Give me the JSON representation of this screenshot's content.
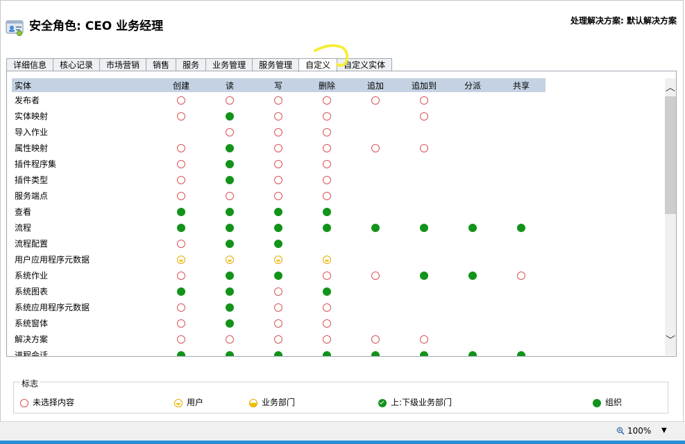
{
  "header": {
    "title": "安全角色: CEO 业务经理",
    "solution": "处理解决方案: 默认解决方案"
  },
  "tabs": [
    {
      "label": "详细信息",
      "active": false
    },
    {
      "label": "核心记录",
      "active": false
    },
    {
      "label": "市场营销",
      "active": false
    },
    {
      "label": "销售",
      "active": false
    },
    {
      "label": "服务",
      "active": false
    },
    {
      "label": "业务管理",
      "active": false
    },
    {
      "label": "服务管理",
      "active": false
    },
    {
      "label": "自定义",
      "active": true
    },
    {
      "label": "自定义实体",
      "active": false
    }
  ],
  "grid": {
    "columns": [
      "实体",
      "创建",
      "读",
      "写",
      "删除",
      "追加",
      "追加到",
      "分派",
      "共享"
    ],
    "rows": [
      {
        "entity": "发布者",
        "p": [
          "none",
          "none",
          "none",
          "none",
          "none",
          "none",
          "",
          ""
        ]
      },
      {
        "entity": "实体映射",
        "p": [
          "none",
          "org",
          "none",
          "none",
          "",
          "none",
          "",
          ""
        ]
      },
      {
        "entity": "导入作业",
        "p": [
          "",
          "none",
          "none",
          "none",
          "",
          "",
          "",
          ""
        ]
      },
      {
        "entity": "属性映射",
        "p": [
          "none",
          "org",
          "none",
          "none",
          "none",
          "none",
          "",
          ""
        ]
      },
      {
        "entity": "插件程序集",
        "p": [
          "none",
          "org",
          "none",
          "none",
          "",
          "",
          "",
          ""
        ]
      },
      {
        "entity": "插件类型",
        "p": [
          "none",
          "org",
          "none",
          "none",
          "",
          "",
          "",
          ""
        ]
      },
      {
        "entity": "服务端点",
        "p": [
          "none",
          "none",
          "none",
          "none",
          "",
          "",
          "",
          ""
        ]
      },
      {
        "entity": "查看",
        "p": [
          "org",
          "org",
          "org",
          "org",
          "",
          "",
          "",
          ""
        ]
      },
      {
        "entity": "流程",
        "p": [
          "org",
          "org",
          "org",
          "org",
          "org",
          "org",
          "org",
          "org"
        ]
      },
      {
        "entity": "流程配置",
        "p": [
          "none",
          "org",
          "org",
          "",
          "",
          "",
          "",
          ""
        ]
      },
      {
        "entity": "用户应用程序元数据",
        "p": [
          "user",
          "user",
          "user",
          "user",
          "",
          "",
          "",
          ""
        ]
      },
      {
        "entity": "系统作业",
        "p": [
          "none",
          "org",
          "org",
          "none",
          "none",
          "org",
          "org",
          "none"
        ]
      },
      {
        "entity": "系统图表",
        "p": [
          "org",
          "org",
          "none",
          "org",
          "",
          "",
          "",
          ""
        ]
      },
      {
        "entity": "系统应用程序元数据",
        "p": [
          "none",
          "org",
          "none",
          "none",
          "",
          "",
          "",
          ""
        ]
      },
      {
        "entity": "系统窗体",
        "p": [
          "none",
          "org",
          "none",
          "none",
          "",
          "",
          "",
          ""
        ]
      },
      {
        "entity": "解决方案",
        "p": [
          "none",
          "none",
          "none",
          "none",
          "none",
          "none",
          "",
          ""
        ]
      },
      {
        "entity": "进程会话",
        "p": [
          "org",
          "org",
          "org",
          "org",
          "org",
          "org",
          "org",
          "org"
        ]
      }
    ]
  },
  "legend": {
    "title": "标志",
    "items": [
      {
        "icon": "none",
        "label": "未选择内容"
      },
      {
        "icon": "user",
        "label": "用户"
      },
      {
        "icon": "bu",
        "label": "业务部门"
      },
      {
        "icon": "pbu",
        "label": "上:下级业务部门"
      },
      {
        "icon": "org",
        "label": "组织"
      }
    ]
  },
  "status": {
    "zoom": "100%"
  },
  "colors": {
    "org_green": "#12931a",
    "none_red": "#d9534f",
    "user_yellow": "#f2c200",
    "header_blue": "#c4d2e3",
    "annotation_yellow": "#f5ee3a"
  }
}
